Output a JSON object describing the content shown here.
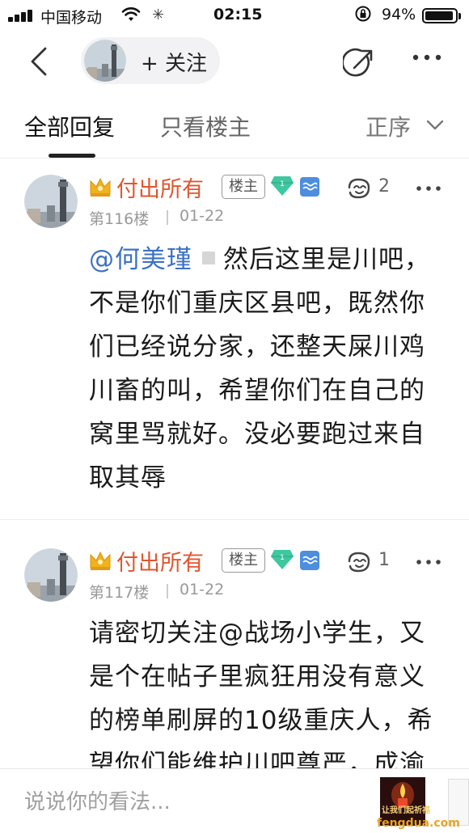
{
  "status_bar": {
    "carrier": "中国移动",
    "time": "02:15",
    "battery": "94%",
    "battery_level": 0.94
  },
  "nav": {
    "follow_label": "+ 关注"
  },
  "tabs": {
    "all_replies": "全部回复",
    "owner_only": "只看楼主",
    "sort": "正序"
  },
  "posts": [
    {
      "username": "付出所有",
      "owner_badge": "楼主",
      "likes": "2",
      "floor": "第116楼",
      "date": "01-22",
      "mention": "@何美瑾",
      "text": "然后这里是川吧，不是你们重庆区县吧，既然你们已经说分家，还整天屎川鸡川畜的叫，希望你们在自己的窝里骂就好。没必要跑过来自取其辱"
    },
    {
      "username": "付出所有",
      "owner_badge": "楼主",
      "likes": "1",
      "floor": "第117楼",
      "date": "01-22",
      "text": "请密切关注@战场小学生，又是个在帖子里疯狂用没有意义的榜单刷屏的10级重庆人，希望你们能维护川吧尊严，成渝"
    }
  ],
  "bottom_bar": {
    "comment_placeholder": "说说你的看法...",
    "thumbnail_caption": "让我们起祈福"
  },
  "watermark": "fengdua.com",
  "colors": {
    "username": "#e0562f",
    "mention": "#3c72c4",
    "gem": "#3fc8a0",
    "blue_badge": "#4d8ede"
  },
  "icons": [
    "back-arrow-icon",
    "share-icon",
    "more-icon",
    "crown-icon",
    "gem-icon",
    "level-badge-icon",
    "like-icon",
    "chevron-down-icon"
  ]
}
